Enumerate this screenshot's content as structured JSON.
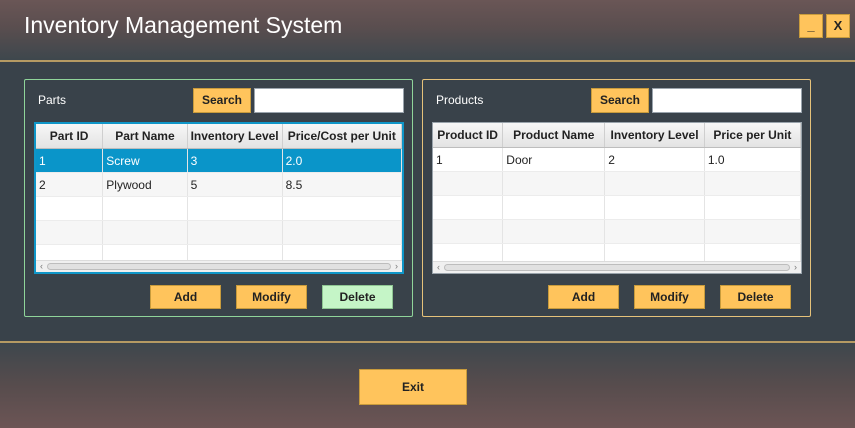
{
  "app": {
    "title": "Inventory Management System"
  },
  "window_controls": {
    "minimize": "_",
    "close": "X"
  },
  "parts": {
    "label": "Parts",
    "search_label": "Search",
    "search_value": "",
    "columns": [
      "Part ID",
      "Part Name",
      "Inventory Level",
      "Price/Cost per Unit"
    ],
    "rows": [
      [
        "1",
        "Screw",
        "3",
        "2.0"
      ],
      [
        "2",
        "Plywood",
        "5",
        "8.5"
      ],
      [
        "",
        "",
        "",
        ""
      ],
      [
        "",
        "",
        "",
        ""
      ],
      [
        "",
        "",
        "",
        ""
      ]
    ],
    "selected_row": 0,
    "buttons": {
      "add": "Add",
      "modify": "Modify",
      "delete": "Delete"
    }
  },
  "products": {
    "label": "Products",
    "search_label": "Search",
    "search_value": "",
    "columns": [
      "Product ID",
      "Product Name",
      "Inventory Level",
      "Price per Unit"
    ],
    "rows": [
      [
        "1",
        "Door",
        "2",
        "1.0"
      ],
      [
        "",
        "",
        "",
        ""
      ],
      [
        "",
        "",
        "",
        ""
      ],
      [
        "",
        "",
        "",
        ""
      ],
      [
        "",
        "",
        "",
        ""
      ]
    ],
    "buttons": {
      "add": "Add",
      "modify": "Modify",
      "delete": "Delete"
    }
  },
  "exit_label": "Exit",
  "colors": {
    "accent_button": "#ffc45c",
    "selection": "#0a95c9",
    "parts_border": "#8fd49a",
    "products_border": "#e6c27a",
    "delete_parts_button": "#c5f5c7"
  }
}
